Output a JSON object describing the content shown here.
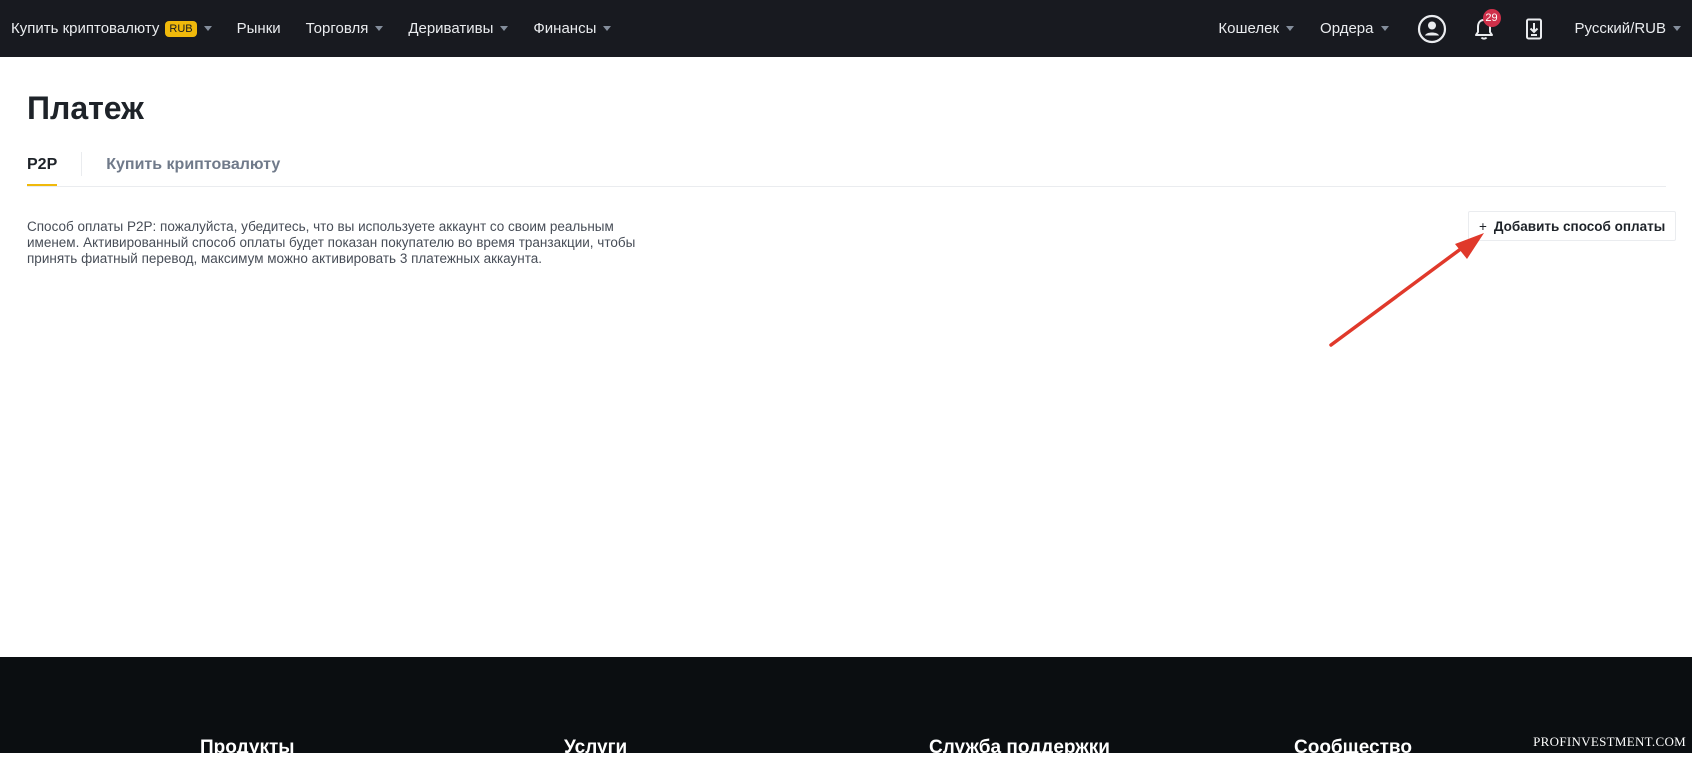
{
  "nav": {
    "left": [
      {
        "label": "Купить криптовалюту",
        "badge": "RUB",
        "dropdown": true
      },
      {
        "label": "Рынки",
        "dropdown": false
      },
      {
        "label": "Торговля",
        "dropdown": true
      },
      {
        "label": "Деривативы",
        "dropdown": true
      },
      {
        "label": "Финансы",
        "dropdown": true
      }
    ],
    "right": {
      "wallet": "Кошелек",
      "orders": "Ордера",
      "notifications_count": "29",
      "language": "Русский/RUB"
    },
    "icons": [
      "user-icon",
      "bell-icon",
      "download-icon"
    ]
  },
  "page": {
    "title": "Платеж",
    "tabs": [
      {
        "label": "P2P",
        "active": true
      },
      {
        "label": "Купить криптовалюту",
        "active": false
      }
    ],
    "notice_line1": "Способ оплаты P2P: пожалуйста, убедитесь, что вы используете аккаунт со своим реальным",
    "notice_line2": "именем. Активированный способ оплаты будет показан покупателю во время транзакции, чтобы",
    "notice_line3": "принять фиатный перевод, максимум можно активировать 3 платежных аккаунта.",
    "add_button": "Добавить способ оплаты",
    "add_button_plus": "+"
  },
  "footer": {
    "columns": [
      "Продукты",
      "Услуги",
      "Служба поддержки",
      "Сообщество"
    ],
    "watermark": "PROFINVESTMENT.COM"
  },
  "colors": {
    "nav_bg": "#181a20",
    "accent": "#f0b90b",
    "badge_red": "#cf304a",
    "annotation_arrow": "#e0392b",
    "footer_bg": "#0b0e11"
  }
}
